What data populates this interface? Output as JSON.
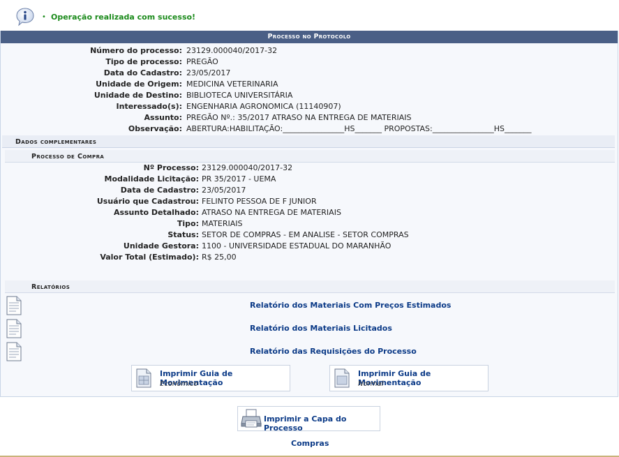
{
  "message": {
    "text": "Operação realizada com sucesso!",
    "bullet": "•"
  },
  "panel": {
    "title": "Processo no Protocolo"
  },
  "processo": [
    {
      "label": "Número do processo:",
      "value": "23129.000040/2017-32"
    },
    {
      "label": "Tipo de processo:",
      "value": "PREGÃO"
    },
    {
      "label": "Data do Cadastro:",
      "value": "23/05/2017"
    },
    {
      "label": "Unidade de Origem:",
      "value": "MEDICINA VETERINARIA"
    },
    {
      "label": "Unidade de Destino:",
      "value": "BIBLIOTECA UNIVERSITÁRIA"
    },
    {
      "label": "Interessado(s):",
      "value": "ENGENHARIA AGRONOMICA (11140907)"
    },
    {
      "label": "Assunto:",
      "value": "PREGÃO Nº.: 35/2017 ATRASO NA ENTREGA DE MATERIAIS"
    },
    {
      "label": "Observação:",
      "value": "ABERTURA:HABILITAÇÃO:________________HS_______ PROPOSTAS:________________HS_______"
    }
  ],
  "dados_complementares": {
    "title": "Dados complementares"
  },
  "processo_compra": {
    "title": "Processo de Compra",
    "rows": [
      {
        "label": "Nº Processo:",
        "value": "23129.000040/2017-32"
      },
      {
        "label": "Modalidade Licitação:",
        "value": "PR 35/2017 - UEMA"
      },
      {
        "label": "Data de Cadastro:",
        "value": "23/05/2017"
      },
      {
        "label": "Usuário que Cadastrou:",
        "value": "FELINTO PESSOA DE F JUNIOR"
      },
      {
        "label": "Assunto Detalhado:",
        "value": "ATRASO NA ENTREGA DE MATERIAIS"
      },
      {
        "label": "Tipo:",
        "value": "MATERIAIS"
      },
      {
        "label": "Status:",
        "value": "SETOR DE COMPRAS - EM ANALISE - SETOR COMPRAS"
      },
      {
        "label": "Unidade Gestora:",
        "value": "1100 - UNIVERSIDADE ESTADUAL DO MARANHÃO"
      },
      {
        "label": "Valor Total (Estimado):",
        "value": "R$ 25,00"
      }
    ]
  },
  "relatorios": {
    "title": "Relatórios",
    "links": [
      "Relatório dos Materiais Com Preços Estimados",
      "Relatório dos Materiais Licitados",
      "Relatório das Requisições do Processo"
    ],
    "guide_buttons": [
      {
        "title": "Imprimir Guia de Movimentação",
        "subtitle": "Econômico"
      },
      {
        "title": "Imprimir Guia de Movimentação",
        "subtitle": "Normal"
      }
    ]
  },
  "actions": {
    "capa": "Imprimir a Capa do Processo",
    "compras": "Compras"
  }
}
